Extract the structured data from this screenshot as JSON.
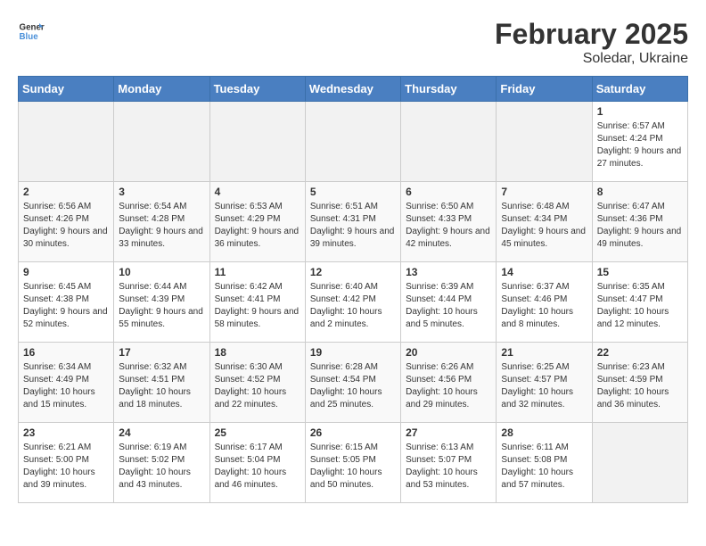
{
  "logo": {
    "text_general": "General",
    "text_blue": "Blue"
  },
  "title": "February 2025",
  "subtitle": "Soledar, Ukraine",
  "days_of_week": [
    "Sunday",
    "Monday",
    "Tuesday",
    "Wednesday",
    "Thursday",
    "Friday",
    "Saturday"
  ],
  "weeks": [
    [
      {
        "day": "",
        "empty": true
      },
      {
        "day": "",
        "empty": true
      },
      {
        "day": "",
        "empty": true
      },
      {
        "day": "",
        "empty": true
      },
      {
        "day": "",
        "empty": true
      },
      {
        "day": "",
        "empty": true
      },
      {
        "day": "1",
        "sunrise": "Sunrise: 6:57 AM",
        "sunset": "Sunset: 4:24 PM",
        "daylight": "Daylight: 9 hours and 27 minutes."
      }
    ],
    [
      {
        "day": "2",
        "sunrise": "Sunrise: 6:56 AM",
        "sunset": "Sunset: 4:26 PM",
        "daylight": "Daylight: 9 hours and 30 minutes."
      },
      {
        "day": "3",
        "sunrise": "Sunrise: 6:54 AM",
        "sunset": "Sunset: 4:28 PM",
        "daylight": "Daylight: 9 hours and 33 minutes."
      },
      {
        "day": "4",
        "sunrise": "Sunrise: 6:53 AM",
        "sunset": "Sunset: 4:29 PM",
        "daylight": "Daylight: 9 hours and 36 minutes."
      },
      {
        "day": "5",
        "sunrise": "Sunrise: 6:51 AM",
        "sunset": "Sunset: 4:31 PM",
        "daylight": "Daylight: 9 hours and 39 minutes."
      },
      {
        "day": "6",
        "sunrise": "Sunrise: 6:50 AM",
        "sunset": "Sunset: 4:33 PM",
        "daylight": "Daylight: 9 hours and 42 minutes."
      },
      {
        "day": "7",
        "sunrise": "Sunrise: 6:48 AM",
        "sunset": "Sunset: 4:34 PM",
        "daylight": "Daylight: 9 hours and 45 minutes."
      },
      {
        "day": "8",
        "sunrise": "Sunrise: 6:47 AM",
        "sunset": "Sunset: 4:36 PM",
        "daylight": "Daylight: 9 hours and 49 minutes."
      }
    ],
    [
      {
        "day": "9",
        "sunrise": "Sunrise: 6:45 AM",
        "sunset": "Sunset: 4:38 PM",
        "daylight": "Daylight: 9 hours and 52 minutes."
      },
      {
        "day": "10",
        "sunrise": "Sunrise: 6:44 AM",
        "sunset": "Sunset: 4:39 PM",
        "daylight": "Daylight: 9 hours and 55 minutes."
      },
      {
        "day": "11",
        "sunrise": "Sunrise: 6:42 AM",
        "sunset": "Sunset: 4:41 PM",
        "daylight": "Daylight: 9 hours and 58 minutes."
      },
      {
        "day": "12",
        "sunrise": "Sunrise: 6:40 AM",
        "sunset": "Sunset: 4:42 PM",
        "daylight": "Daylight: 10 hours and 2 minutes."
      },
      {
        "day": "13",
        "sunrise": "Sunrise: 6:39 AM",
        "sunset": "Sunset: 4:44 PM",
        "daylight": "Daylight: 10 hours and 5 minutes."
      },
      {
        "day": "14",
        "sunrise": "Sunrise: 6:37 AM",
        "sunset": "Sunset: 4:46 PM",
        "daylight": "Daylight: 10 hours and 8 minutes."
      },
      {
        "day": "15",
        "sunrise": "Sunrise: 6:35 AM",
        "sunset": "Sunset: 4:47 PM",
        "daylight": "Daylight: 10 hours and 12 minutes."
      }
    ],
    [
      {
        "day": "16",
        "sunrise": "Sunrise: 6:34 AM",
        "sunset": "Sunset: 4:49 PM",
        "daylight": "Daylight: 10 hours and 15 minutes."
      },
      {
        "day": "17",
        "sunrise": "Sunrise: 6:32 AM",
        "sunset": "Sunset: 4:51 PM",
        "daylight": "Daylight: 10 hours and 18 minutes."
      },
      {
        "day": "18",
        "sunrise": "Sunrise: 6:30 AM",
        "sunset": "Sunset: 4:52 PM",
        "daylight": "Daylight: 10 hours and 22 minutes."
      },
      {
        "day": "19",
        "sunrise": "Sunrise: 6:28 AM",
        "sunset": "Sunset: 4:54 PM",
        "daylight": "Daylight: 10 hours and 25 minutes."
      },
      {
        "day": "20",
        "sunrise": "Sunrise: 6:26 AM",
        "sunset": "Sunset: 4:56 PM",
        "daylight": "Daylight: 10 hours and 29 minutes."
      },
      {
        "day": "21",
        "sunrise": "Sunrise: 6:25 AM",
        "sunset": "Sunset: 4:57 PM",
        "daylight": "Daylight: 10 hours and 32 minutes."
      },
      {
        "day": "22",
        "sunrise": "Sunrise: 6:23 AM",
        "sunset": "Sunset: 4:59 PM",
        "daylight": "Daylight: 10 hours and 36 minutes."
      }
    ],
    [
      {
        "day": "23",
        "sunrise": "Sunrise: 6:21 AM",
        "sunset": "Sunset: 5:00 PM",
        "daylight": "Daylight: 10 hours and 39 minutes."
      },
      {
        "day": "24",
        "sunrise": "Sunrise: 6:19 AM",
        "sunset": "Sunset: 5:02 PM",
        "daylight": "Daylight: 10 hours and 43 minutes."
      },
      {
        "day": "25",
        "sunrise": "Sunrise: 6:17 AM",
        "sunset": "Sunset: 5:04 PM",
        "daylight": "Daylight: 10 hours and 46 minutes."
      },
      {
        "day": "26",
        "sunrise": "Sunrise: 6:15 AM",
        "sunset": "Sunset: 5:05 PM",
        "daylight": "Daylight: 10 hours and 50 minutes."
      },
      {
        "day": "27",
        "sunrise": "Sunrise: 6:13 AM",
        "sunset": "Sunset: 5:07 PM",
        "daylight": "Daylight: 10 hours and 53 minutes."
      },
      {
        "day": "28",
        "sunrise": "Sunrise: 6:11 AM",
        "sunset": "Sunset: 5:08 PM",
        "daylight": "Daylight: 10 hours and 57 minutes."
      },
      {
        "day": "",
        "empty": true
      }
    ]
  ]
}
